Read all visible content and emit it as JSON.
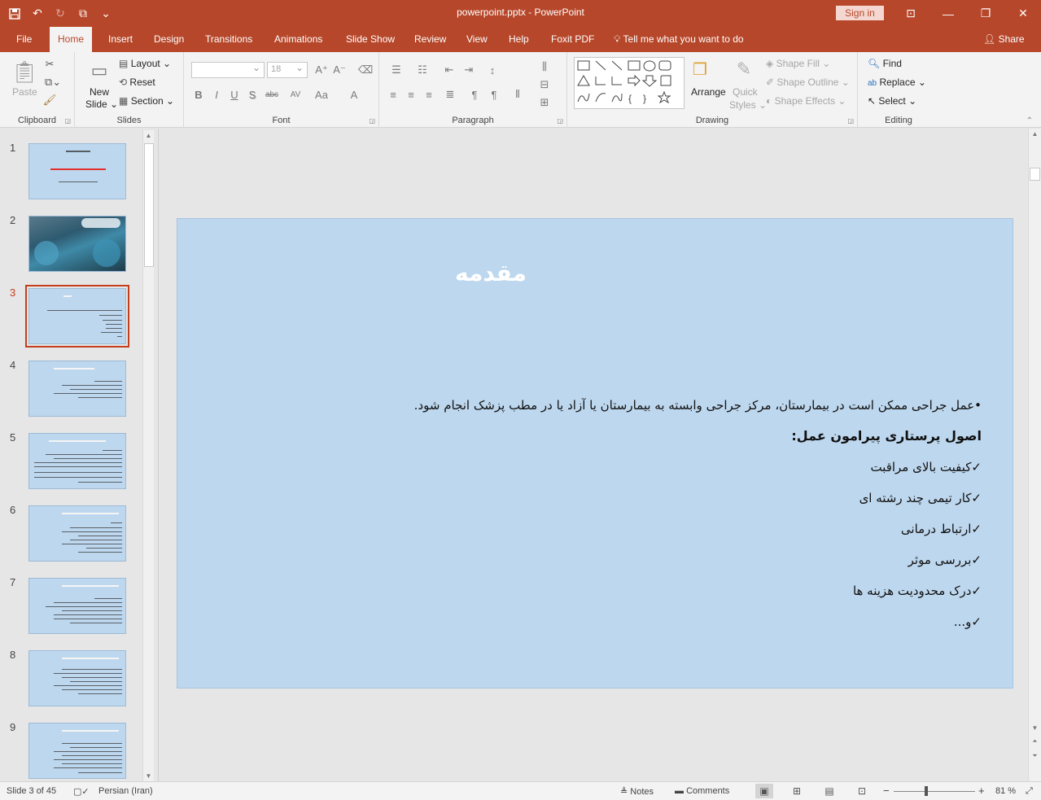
{
  "titlebar": {
    "title": "powerpoint.pptx  -  PowerPoint",
    "sign_in": "Sign in"
  },
  "tabs": [
    "File",
    "Home",
    "Insert",
    "Design",
    "Transitions",
    "Animations",
    "Slide Show",
    "Review",
    "View",
    "Help",
    "Foxit PDF"
  ],
  "tell_me": "Tell me what you want to do",
  "share": "Share",
  "ribbon": {
    "clipboard": {
      "label": "Clipboard",
      "paste": "Paste"
    },
    "slides": {
      "label": "Slides",
      "new_slide_1": "New",
      "new_slide_2": "Slide",
      "layout": "Layout",
      "reset": "Reset",
      "section": "Section"
    },
    "font": {
      "label": "Font",
      "size": "18",
      "bold": "B",
      "italic": "I",
      "underline": "U",
      "shadow": "S",
      "strike": "abc",
      "spacing": "AV",
      "case": "Aa",
      "color": "A"
    },
    "paragraph": {
      "label": "Paragraph"
    },
    "drawing": {
      "label": "Drawing",
      "arrange": "Arrange",
      "quick_styles_1": "Quick",
      "quick_styles_2": "Styles",
      "shape_fill": "Shape Fill",
      "shape_outline": "Shape Outline",
      "shape_effects": "Shape Effects"
    },
    "editing": {
      "label": "Editing",
      "find": "Find",
      "replace": "Replace",
      "select": "Select"
    }
  },
  "thumbnails": [
    {
      "num": "1"
    },
    {
      "num": "2"
    },
    {
      "num": "3"
    },
    {
      "num": "4"
    },
    {
      "num": "5"
    },
    {
      "num": "6"
    },
    {
      "num": "7"
    },
    {
      "num": "8"
    },
    {
      "num": "9"
    }
  ],
  "slide": {
    "title": "مقدمه",
    "bullet": "•عمل جراحی ممکن است در بیمارستان، مرکز جراحی وابسته به بیمارستان یا آزاد یا در مطب پزشک انجام شود.",
    "heading": "اصول پرستاری پیرامون عمل:",
    "items": [
      "✓کیفیت بالای مراقبت",
      "✓کار تیمی چند رشته ای",
      "✓ارتباط درمانی",
      "✓بررسی موثر",
      "✓درک محدودیت هزینه ها",
      "✓و..."
    ]
  },
  "status": {
    "slide_info": "Slide 3 of 45",
    "language": "Persian (Iran)",
    "notes": "Notes",
    "comments": "Comments",
    "zoom": "81 %"
  }
}
